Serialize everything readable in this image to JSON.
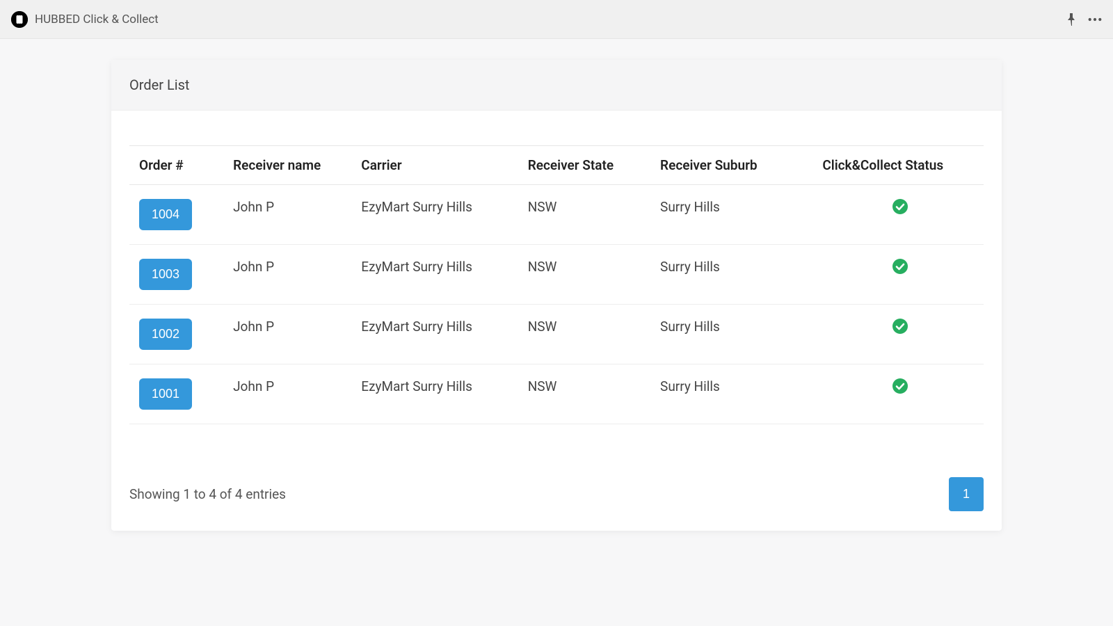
{
  "header": {
    "title": "HUBBED Click & Collect",
    "pin_icon": "pin-icon",
    "more_icon": "more-icon"
  },
  "card": {
    "title": "Order List"
  },
  "table": {
    "columns": {
      "order": "Order #",
      "receiver_name": "Receiver name",
      "carrier": "Carrier",
      "receiver_state": "Receiver State",
      "receiver_suburb": "Receiver Suburb",
      "status": "Click&Collect Status"
    },
    "rows": [
      {
        "order": "1004",
        "receiver_name": "John P",
        "carrier": "EzyMart Surry Hills",
        "receiver_state": "NSW",
        "receiver_suburb": "Surry Hills",
        "status": "ok"
      },
      {
        "order": "1003",
        "receiver_name": "John P",
        "carrier": "EzyMart Surry Hills",
        "receiver_state": "NSW",
        "receiver_suburb": "Surry Hills",
        "status": "ok"
      },
      {
        "order": "1002",
        "receiver_name": "John P",
        "carrier": "EzyMart Surry Hills",
        "receiver_state": "NSW",
        "receiver_suburb": "Surry Hills",
        "status": "ok"
      },
      {
        "order": "1001",
        "receiver_name": "John P",
        "carrier": "EzyMart Surry Hills",
        "receiver_state": "NSW",
        "receiver_suburb": "Surry Hills",
        "status": "ok"
      }
    ]
  },
  "footer": {
    "showing": "Showing 1 to 4 of 4 entries"
  },
  "pagination": {
    "pages": [
      "1"
    ]
  },
  "colors": {
    "primary": "#3498db",
    "success": "#27ae60"
  }
}
